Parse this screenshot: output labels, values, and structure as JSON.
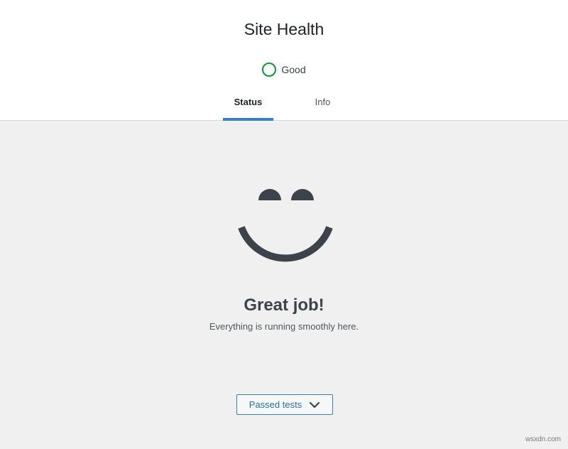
{
  "header": {
    "title": "Site Health",
    "status": {
      "label": "Good",
      "color": "#00a32a",
      "icon": "status-circle-icon"
    },
    "tabs": [
      {
        "label": "Status",
        "active": true
      },
      {
        "label": "Info",
        "active": false
      }
    ],
    "accent_color": "#3582c4"
  },
  "main": {
    "illustration": "smiley-face-icon",
    "title": "Great job!",
    "subtitle": "Everything is running smoothly here.",
    "passed_tests_button": {
      "label": "Passed tests",
      "icon": "chevron-down-icon"
    }
  },
  "watermark": "wsxdn.com"
}
